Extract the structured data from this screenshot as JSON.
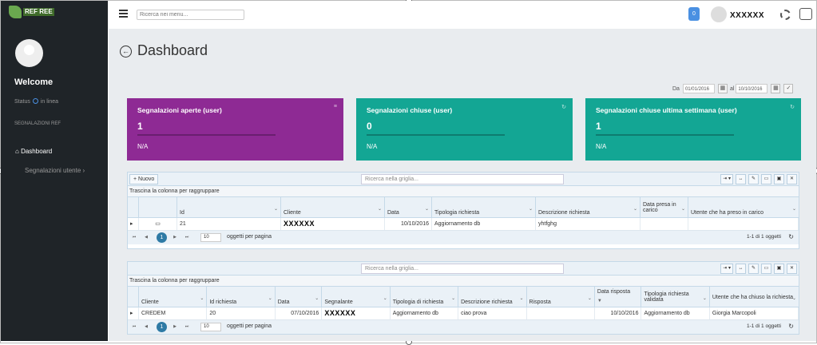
{
  "sidebar": {
    "logo_text": "REF REE",
    "welcome": "Welcome",
    "status_label": "Status",
    "status_value": "in linea",
    "section": "SEGNALAZIONI REF",
    "nav_dashboard": "Dashboard",
    "nav_segnalazioni": "Segnalazioni utente"
  },
  "topbar": {
    "search_placeholder": "Ricerca nei menu...",
    "notifications": "0",
    "username": "XXXXXX"
  },
  "page": {
    "title": "Dashboard"
  },
  "daterange": {
    "from_label": "Da",
    "from": "01/01/2016",
    "to_label": "al",
    "to": "10/10/2016"
  },
  "cards": [
    {
      "title": "Segnalazioni aperte (user)",
      "value": "1",
      "footer": "N/A",
      "color": "#8e2a94"
    },
    {
      "title": "Segnalazioni chiuse (user)",
      "value": "0",
      "footer": "N/A",
      "color": "#13a694"
    },
    {
      "title": "Segnalazioni chiuse ultima settimana (user)",
      "value": "1",
      "footer": "N/A",
      "color": "#13a694"
    }
  ],
  "grid1": {
    "new_label": "Nuovo",
    "search_placeholder": "Ricerca nella griglia...",
    "group_hint": "Trascina la colonna per raggruppare",
    "headers": [
      "Id",
      "Cliente",
      "Data",
      "Tipologia richiesta",
      "Descrizione richiesta",
      "Data presa in carico",
      "Utente che ha preso in carico"
    ],
    "row": {
      "id": "21",
      "cliente": "XXXXXX",
      "data": "10/10/2016",
      "tipologia": "Aggiornamento db",
      "descrizione": "yhtfghg",
      "presa": "",
      "utente": ""
    },
    "page": "1",
    "per_page": "10",
    "per_page_label": "oggetti per pagina",
    "info": "1-1 di 1 oggetti"
  },
  "grid2": {
    "search_placeholder": "Ricerca nella griglia...",
    "group_hint": "Trascina la colonna per raggruppare",
    "headers": [
      "Cliente",
      "Id richiesta",
      "Data",
      "Segnalante",
      "Tipologia di richiesta",
      "Descrizione richiesta",
      "Risposta",
      "Data risposta",
      "Tipologia richiesta validata",
      "Utente che ha chiuso la richiesta"
    ],
    "row": {
      "cliente": "CREDEM",
      "id": "20",
      "data": "07/10/2016",
      "segnalante": "XXXXXX",
      "tipologia": "Aggiornamento db",
      "descrizione": "ciao prova",
      "risposta": "",
      "data_risposta": "10/10/2016",
      "validata": "Aggiornamento db",
      "utente": "Giorgia Marcopoli"
    },
    "page": "1",
    "per_page": "10",
    "per_page_label": "oggetti per pagina",
    "info": "1-1 di 1 oggetti"
  }
}
